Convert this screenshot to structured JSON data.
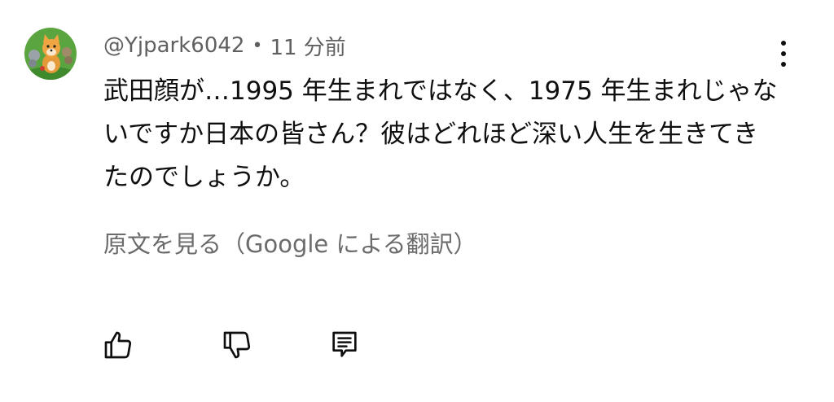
{
  "comment": {
    "author": "@Yjpark6042",
    "separator": "•",
    "time": "11 分前",
    "text": "武田顔が…1995 年生まれではなく、1975 年生まれじゃないですか日本の皆さん？彼はどれほど深い人生を生きてきたのでしょうか。",
    "translate_label": "原文を見る（Google による翻訳）"
  },
  "icons": {
    "avatar": "shiba-dog-avatar",
    "menu": "more-vert-icon",
    "like": "thumb-up-icon",
    "dislike": "thumb-down-icon",
    "reply": "comment-icon"
  },
  "colors": {
    "text": "#0f0f0f",
    "secondary": "#606060",
    "avatar_bg": "#5aa53f"
  }
}
